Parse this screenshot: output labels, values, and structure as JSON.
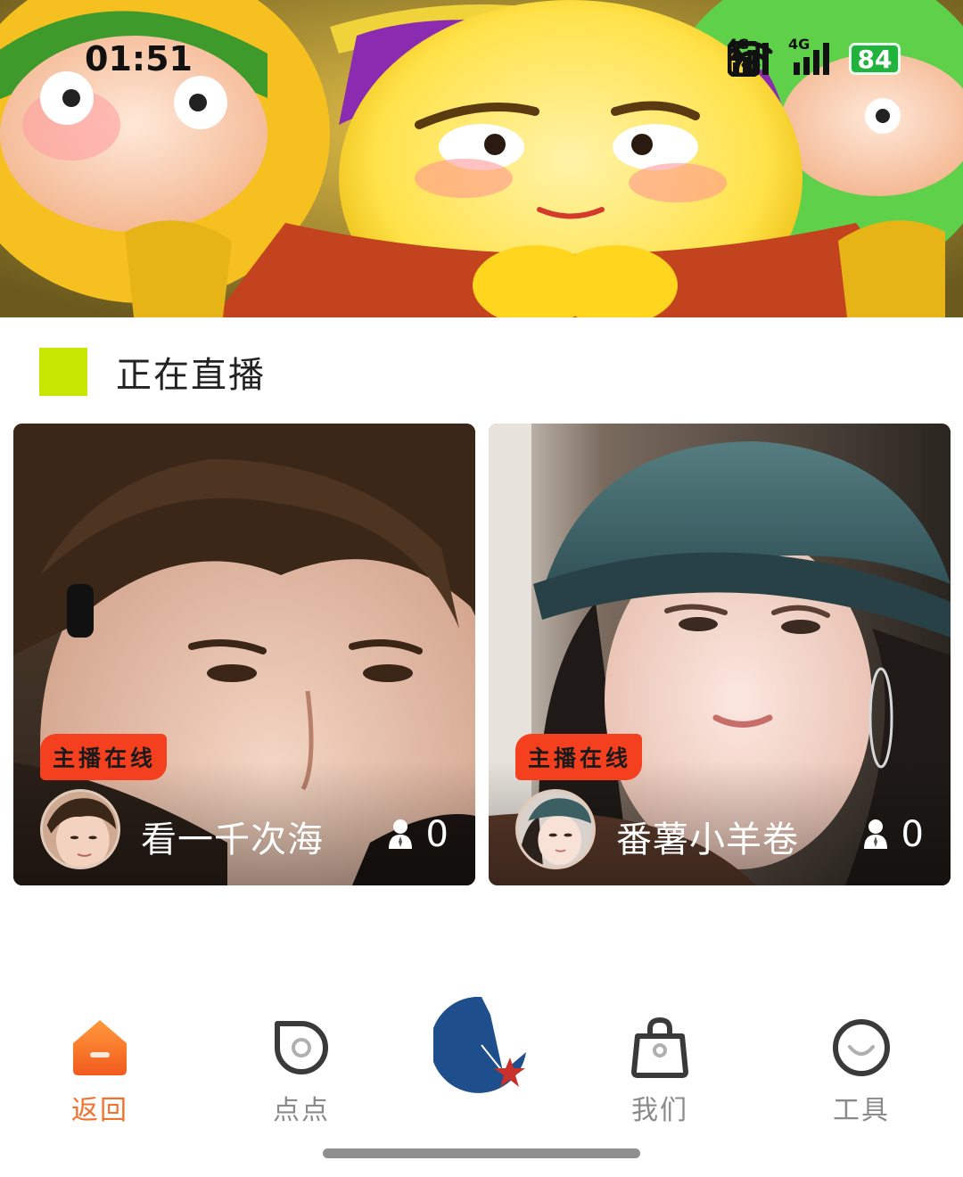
{
  "status_bar": {
    "time": "01:51",
    "nfc_icon": "nfc-icon",
    "wifi_icon": "wifi-icon",
    "signal_1": "signal-4g-icon",
    "signal_2": "signal-4g-icon",
    "network_1": "4G",
    "network_2": "4G",
    "battery_level": "84",
    "charging_icon": "charging-bolt-icon"
  },
  "section": {
    "title": "正在直播",
    "accent_color": "#c7e600"
  },
  "live_cards": [
    {
      "badge": "主播在线",
      "name": "看一千次海",
      "viewers": "0"
    },
    {
      "badge": "主播在线",
      "name": "番薯小羊卷",
      "viewers": "0"
    }
  ],
  "bottom_nav": {
    "items": [
      {
        "label": "返回",
        "icon": "home-icon",
        "active": true
      },
      {
        "label": "点点",
        "icon": "record-icon",
        "active": false
      },
      {
        "label": "",
        "icon": "app-logo-star-icon",
        "active": false
      },
      {
        "label": "我们",
        "icon": "shopping-bag-icon",
        "active": false
      },
      {
        "label": "工具",
        "icon": "circle-smile-icon",
        "active": false
      }
    ],
    "active_color": "#f2712c",
    "inactive_color": "#8a8a8a",
    "logo_color": "#1f4e8c",
    "star_color": "#c8302c"
  }
}
